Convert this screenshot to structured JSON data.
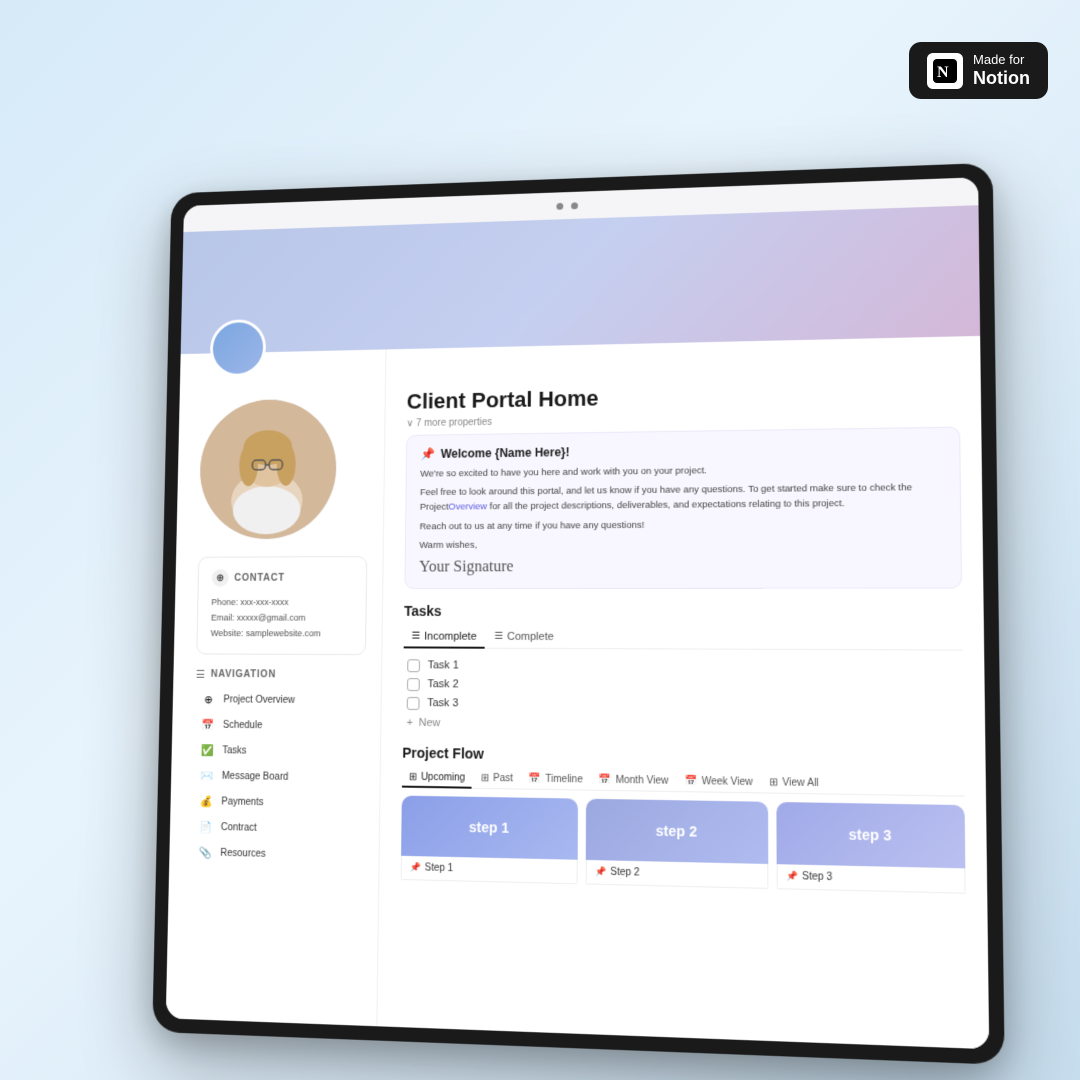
{
  "badge": {
    "made_for": "Made for",
    "notion": "Notion",
    "icon_text": "N"
  },
  "page": {
    "title": "Client Portal Home",
    "properties_toggle": "∨  7 more properties"
  },
  "welcome": {
    "pin_icon": "📌",
    "title": "Welcome {Name Here}!",
    "line1": "We're so excited to have you here and work with you on your project.",
    "line2": "Feel free to look around this portal, and let us know if you have any questions. To get started make sure to check the Project",
    "link_text": "Overview",
    "line3": " for all the project descriptions, deliverables, and expectations relating to this project.",
    "line4": "Reach out to us at any time if you have any questions!",
    "warm_wishes": "Warm wishes,",
    "signature": "Your Signature"
  },
  "contact": {
    "section_title": "CONTACT",
    "phone_label": "Phone:",
    "phone_value": "xxx-xxx-xxxx",
    "email_label": "Email:",
    "email_value": "xxxxx@gmail.com",
    "website_label": "Website:",
    "website_value": "samplewebsite.com"
  },
  "navigation": {
    "section_title": "NAVIGATION",
    "items": [
      {
        "label": "Project Overview",
        "icon": "⊕"
      },
      {
        "label": "Schedule",
        "icon": "📅"
      },
      {
        "label": "Tasks",
        "icon": "✅"
      },
      {
        "label": "Message Board",
        "icon": "✉️"
      },
      {
        "label": "Payments",
        "icon": "💰"
      },
      {
        "label": "Contract",
        "icon": "📄"
      },
      {
        "label": "Resources",
        "icon": "📎"
      }
    ]
  },
  "tasks": {
    "section_title": "Tasks",
    "tabs": [
      {
        "label": "Incomplete",
        "icon": "☰",
        "active": true
      },
      {
        "label": "Complete",
        "icon": "☰",
        "active": false
      }
    ],
    "items": [
      {
        "label": "Task 1"
      },
      {
        "label": "Task 2"
      },
      {
        "label": "Task 3"
      }
    ],
    "add_new": "New"
  },
  "project_flow": {
    "section_title": "Project Flow",
    "tabs": [
      {
        "label": "Upcoming",
        "icon": "⊞",
        "active": true
      },
      {
        "label": "Past",
        "icon": "⊞",
        "active": false
      },
      {
        "label": "Timeline",
        "icon": "📅",
        "active": false
      },
      {
        "label": "Month View",
        "icon": "📅",
        "active": false
      },
      {
        "label": "Week View",
        "icon": "📅",
        "active": false
      },
      {
        "label": "View All",
        "icon": "⊞",
        "active": false
      }
    ],
    "steps": [
      {
        "card_label": "step 1",
        "item_label": "Step 1",
        "pin": "📌"
      },
      {
        "card_label": "step 2",
        "item_label": "Step 2",
        "pin": "📌"
      },
      {
        "card_label": "step 3",
        "item_label": "Step 3",
        "pin": "📌"
      }
    ]
  }
}
